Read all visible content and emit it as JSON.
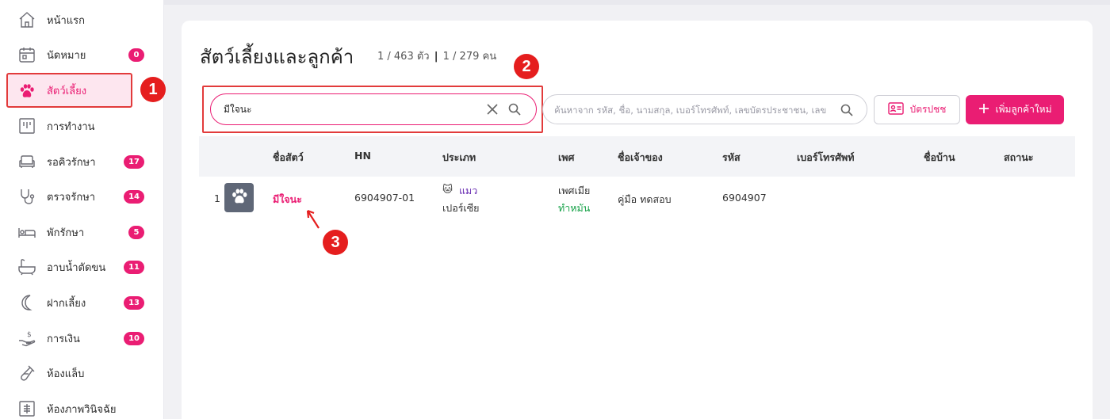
{
  "sidebar": {
    "items": [
      {
        "label": "หน้าแรก",
        "badge": "",
        "icon": "home-icon"
      },
      {
        "label": "นัดหมาย",
        "badge": "0",
        "icon": "calendar-icon"
      },
      {
        "label": "สัตว์เลี้ยง",
        "badge": "",
        "icon": "paw-icon",
        "active": true
      },
      {
        "label": "การทำงาน",
        "badge": "",
        "icon": "work-board-icon"
      },
      {
        "label": "รอคิวรักษา",
        "badge": "17",
        "icon": "sofa-icon"
      },
      {
        "label": "ตรวจรักษา",
        "badge": "14",
        "icon": "stethoscope-icon"
      },
      {
        "label": "พักรักษา",
        "badge": "5",
        "icon": "bed-icon"
      },
      {
        "label": "อาบน้ำตัดขน",
        "badge": "11",
        "icon": "bathtub-icon"
      },
      {
        "label": "ฝากเลี้ยง",
        "badge": "13",
        "icon": "moon-icon"
      },
      {
        "label": "การเงิน",
        "badge": "10",
        "icon": "money-hand-icon"
      },
      {
        "label": "ห้องแล็บ",
        "badge": "",
        "icon": "test-tube-icon"
      },
      {
        "label": "ห้องภาพวินิจฉัย",
        "badge": "",
        "icon": "xray-icon"
      }
    ]
  },
  "markers": [
    "1",
    "2",
    "3"
  ],
  "page": {
    "title": "สัตว์เลี้ยงและลูกค้า",
    "pet_count": "1 / 463 ตัว",
    "count_separator": "|",
    "customer_count": "1 / 279 คน"
  },
  "search": {
    "pet_value": "มีใจนะ",
    "customer_placeholder": "ค้นหาจาก รหัส, ชื่อ, นามสกุล, เบอร์โทรศัพท์, เลขบัตรประชาชน, เลข"
  },
  "buttons": {
    "id_card": "บัตรปชช",
    "add_customer": "เพิ่มลูกค้าใหม่"
  },
  "table": {
    "headers": [
      "ชื่อสัตว์",
      "HN",
      "ประเภท",
      "เพศ",
      "ชื่อเจ้าของ",
      "รหัส",
      "เบอร์โทรศัพท์",
      "ชื่อบ้าน",
      "สถานะ"
    ],
    "rows": [
      {
        "index": "1",
        "pet_name": "มีใจนะ",
        "hn": "6904907-01",
        "type_emoji": "🐱",
        "type": "แมว",
        "breed": "เปอร์เซีย",
        "sex": "เพศเมีย",
        "neutered": "ทำหมัน",
        "owner": "คู่มือ ทดสอบ",
        "code": "6904907",
        "phone": "",
        "house_name": "",
        "status": ""
      }
    ]
  },
  "colors": {
    "accent": "#ea1d73",
    "marker": "#e51e1e",
    "neutered": "#19a34a",
    "cat_type": "#6a2fb3"
  }
}
